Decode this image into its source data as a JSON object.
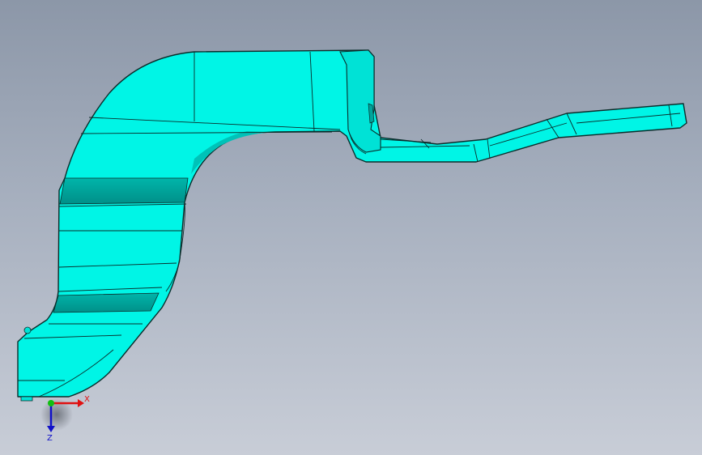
{
  "viewport": {
    "background_top": "#8c97a8",
    "background_bottom": "#c8cdd7"
  },
  "part": {
    "fill_color": "#00f5e6",
    "shade_color": "#00c8bd",
    "dark_shade_color": "#009d95",
    "edge_color": "#0a2d2b"
  },
  "triad": {
    "x_label": "X",
    "z_label": "Z",
    "x_color": "#e01010",
    "z_color": "#1010c8",
    "origin_color": "#10c010"
  }
}
